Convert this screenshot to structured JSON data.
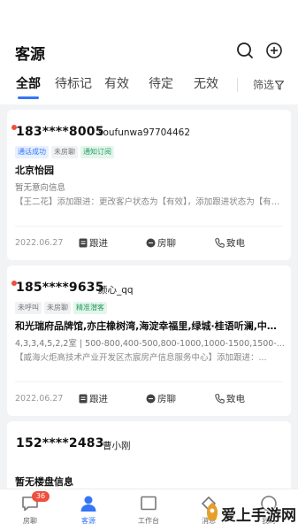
{
  "header": {
    "title": "客源"
  },
  "tabs": [
    {
      "label": "全部"
    },
    {
      "label": "待标记"
    },
    {
      "label": "有效"
    },
    {
      "label": "待定"
    },
    {
      "label": "无效"
    }
  ],
  "filter_label": "筛选",
  "cards": [
    {
      "phone": "183****8005",
      "name": "soufunwa97704462",
      "tags": [
        "通话成功",
        "未房聊",
        "通知订阅"
      ],
      "title": "北京怡园",
      "subtitle": "暂无意向信息",
      "log": "【王二花】添加跟进：更改客户状态为【有效】，添加跟进状态为【有效】",
      "date": "2022.06.27",
      "actions": [
        "跟进",
        "房聊",
        "致电"
      ]
    },
    {
      "phone": "185****9635",
      "name": "颜心_qq",
      "tags": [
        "未呼叫",
        "未房聊",
        "精准潜客"
      ],
      "title": "和光瑞府品牌馆,亦庄橡树湾,海淀幸福里,绿城·桂语听澜,中铁...",
      "subtitle": "4,3,3,4,5,2,2室 | 500-800,400-500,800-1000,1000-1500,1500-...",
      "log": "【威海火炬高技术产业开发区杰宸房产信息服务中心】添加跟进：...",
      "date": "2022.06.27",
      "actions": [
        "跟进",
        "房聊",
        "致电"
      ]
    },
    {
      "phone": "152****2483",
      "name": "曹小刚",
      "title": "暂无楼盘信息"
    }
  ],
  "tabbar": {
    "items": [
      {
        "label": "房聊",
        "badge": "36"
      },
      {
        "label": "客源"
      },
      {
        "label": "工作台"
      },
      {
        "label": "消息"
      },
      {
        "label": "我的"
      }
    ]
  },
  "watermark": "爱上手游网",
  "colors": {
    "accent": "#3576f6",
    "unread_dot": "#f04f3e",
    "background": "#f2f3f5"
  }
}
